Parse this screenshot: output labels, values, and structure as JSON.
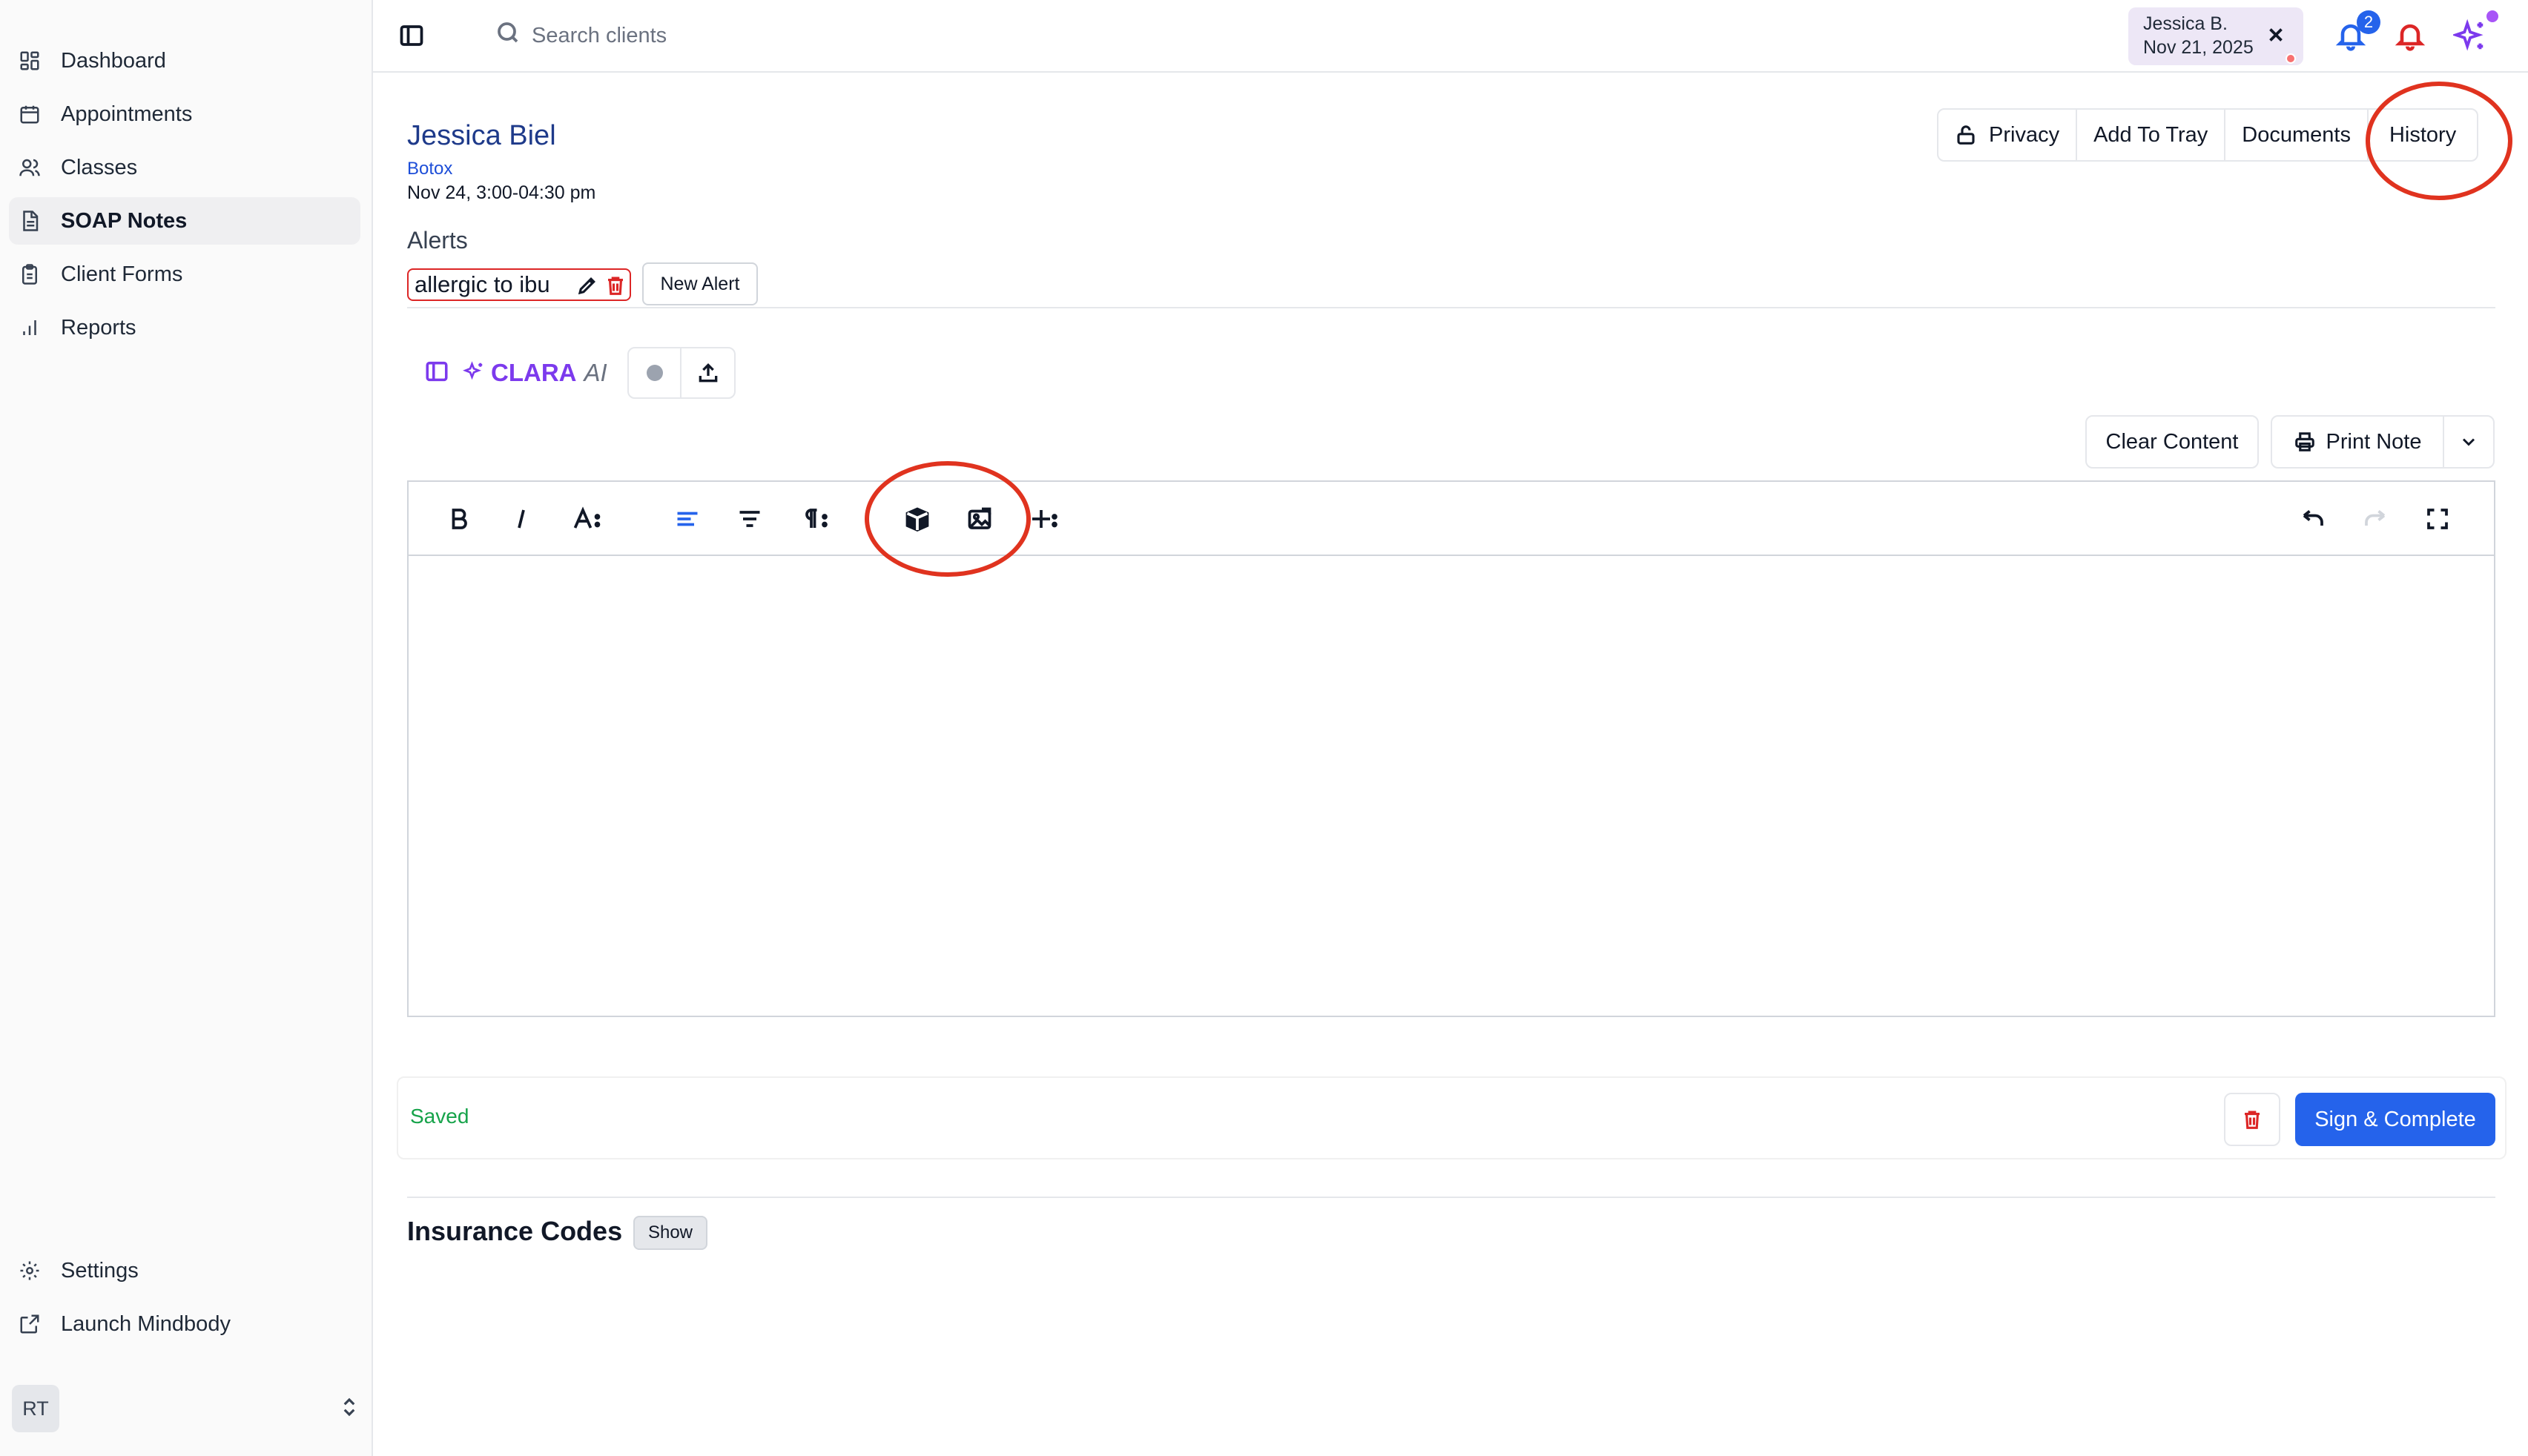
{
  "sidebar": {
    "items": [
      {
        "label": "Dashboard",
        "icon": "grid-icon"
      },
      {
        "label": "Appointments",
        "icon": "calendar-icon"
      },
      {
        "label": "Classes",
        "icon": "users-icon"
      },
      {
        "label": "SOAP Notes",
        "icon": "document-icon",
        "active": true
      },
      {
        "label": "Client Forms",
        "icon": "clipboard-icon"
      },
      {
        "label": "Reports",
        "icon": "bar-chart-icon"
      }
    ],
    "bottom_items": [
      {
        "label": "Settings",
        "icon": "gear-icon"
      },
      {
        "label": "Launch Mindbody",
        "icon": "external-link-icon"
      }
    ],
    "user_initials": "RT"
  },
  "topbar": {
    "search_placeholder": "Search clients",
    "client_chip": {
      "name": "Jessica B.",
      "date": "Nov 21, 2025"
    },
    "notification_count": "2"
  },
  "client": {
    "name": "Jessica Biel",
    "service": "Botox",
    "appointment_time": "Nov 24, 3:00-04:30 pm"
  },
  "header_buttons": {
    "privacy": "Privacy",
    "add_to_tray": "Add To Tray",
    "documents": "Documents",
    "history": "History"
  },
  "alerts": {
    "label": "Alerts",
    "items": [
      "allergic to ibu"
    ],
    "new_alert": "New Alert"
  },
  "clara": {
    "name": "CLARA",
    "suffix": "AI"
  },
  "actions": {
    "clear_content": "Clear Content",
    "print_note": "Print Note"
  },
  "editor": {
    "toolbar": [
      "bold",
      "italic",
      "font-size",
      "align-left",
      "align-center",
      "paragraph",
      "template-box",
      "insert-image",
      "insert-more",
      "undo",
      "redo",
      "fullscreen"
    ]
  },
  "footer": {
    "status": "Saved",
    "sign_complete": "Sign & Complete"
  },
  "insurance": {
    "title": "Insurance Codes",
    "show": "Show"
  },
  "colors": {
    "accent": "#2563eb",
    "brand_purple": "#7c3aed",
    "alert_red": "#dc2626",
    "saved_green": "#16a34a",
    "annotation_red": "#e0331f"
  }
}
